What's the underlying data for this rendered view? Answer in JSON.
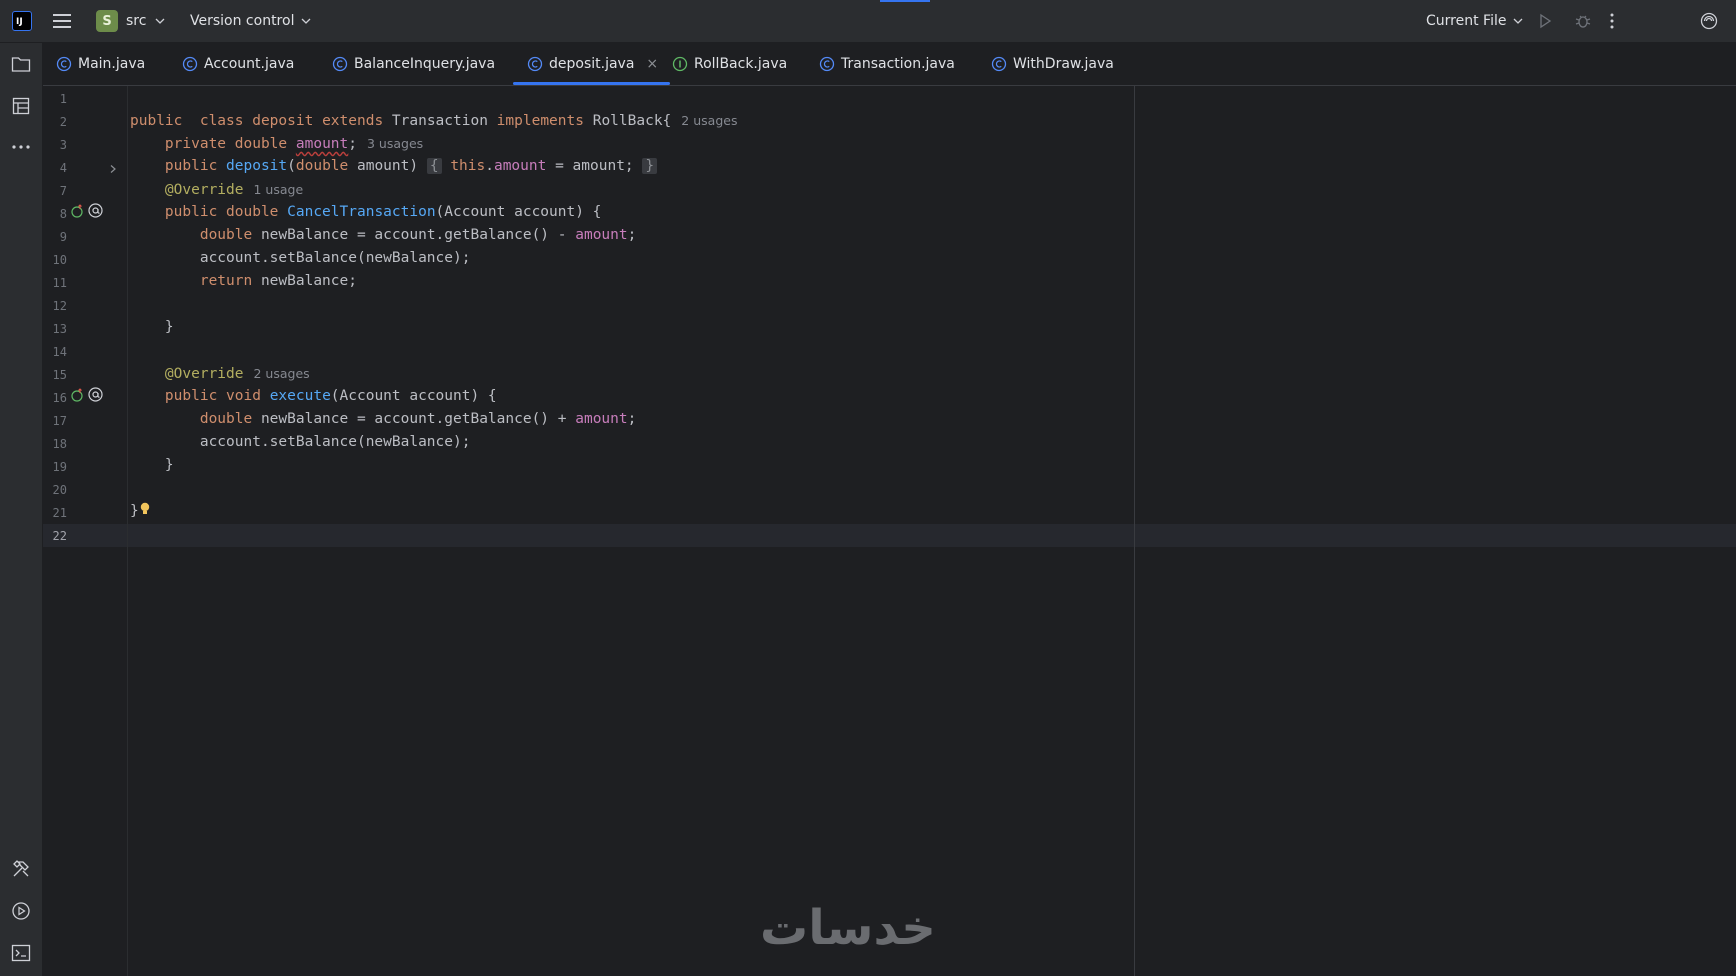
{
  "titlebar": {
    "app_logo_text": "IJ",
    "project_badge": "S",
    "project_name": "src",
    "vcs_label": "Version control",
    "run_config": "Current File"
  },
  "tabs": [
    {
      "label": "Main.java",
      "icon": "class-icon"
    },
    {
      "label": "Account.java",
      "icon": "class-icon"
    },
    {
      "label": "BalanceInquery.java",
      "icon": "class-icon"
    },
    {
      "label": "deposit.java",
      "icon": "class-icon",
      "active": true,
      "close": "×"
    },
    {
      "label": "RollBack.java",
      "icon": "interface-icon"
    },
    {
      "label": "Transaction.java",
      "icon": "class-icon"
    },
    {
      "label": "WithDraw.java",
      "icon": "class-icon"
    }
  ],
  "editor": {
    "line_numbers": [
      "1",
      "2",
      "3",
      "4",
      "7",
      "8",
      "9",
      "10",
      "11",
      "12",
      "13",
      "14",
      "15",
      "16",
      "17",
      "18",
      "19",
      "20",
      "21",
      "22"
    ],
    "hints": {
      "class_usages": "2 usages",
      "amount_usages": "3 usages",
      "cancel_usage": "1 usage",
      "execute_usages": "2 usages"
    },
    "lines": {
      "l2_a": "public  class deposit ",
      "l2_b": "extends",
      "l2_c": " Transaction ",
      "l2_d": "implements",
      "l2_e": " RollBack{",
      "l3_a": "    private double ",
      "l3_b": "amount",
      "l3_c": ";",
      "l4_a": "    public ",
      "l4_b": "deposit",
      "l4_c": "(",
      "l4_d": "double",
      "l4_e": " amount) ",
      "l4_f": "{",
      "l4_g": "this",
      "l4_h": ".",
      "l4_i": "amount",
      "l4_j": " = amount; ",
      "l4_k": "}",
      "l7": "    @Override",
      "l8_a": "    public double ",
      "l8_b": "CancelTransaction",
      "l8_c": "(Account account) {",
      "l9_a": "        double",
      "l9_b": " newBalance = account.getBalance() - ",
      "l9_c": "amount",
      "l9_d": ";",
      "l10": "        account.setBalance(newBalance);",
      "l11_a": "        return",
      "l11_b": " newBalance;",
      "l13": "    }",
      "l15": "    @Override",
      "l16_a": "    public void ",
      "l16_b": "execute",
      "l16_c": "(Account account) {",
      "l17_a": "        double",
      "l17_b": " newBalance = account.getBalance() + ",
      "l17_c": "amount",
      "l17_d": ";",
      "l18": "        account.setBalance(newBalance);",
      "l19": "    }",
      "l21": "}"
    }
  },
  "watermark": "خدسات"
}
